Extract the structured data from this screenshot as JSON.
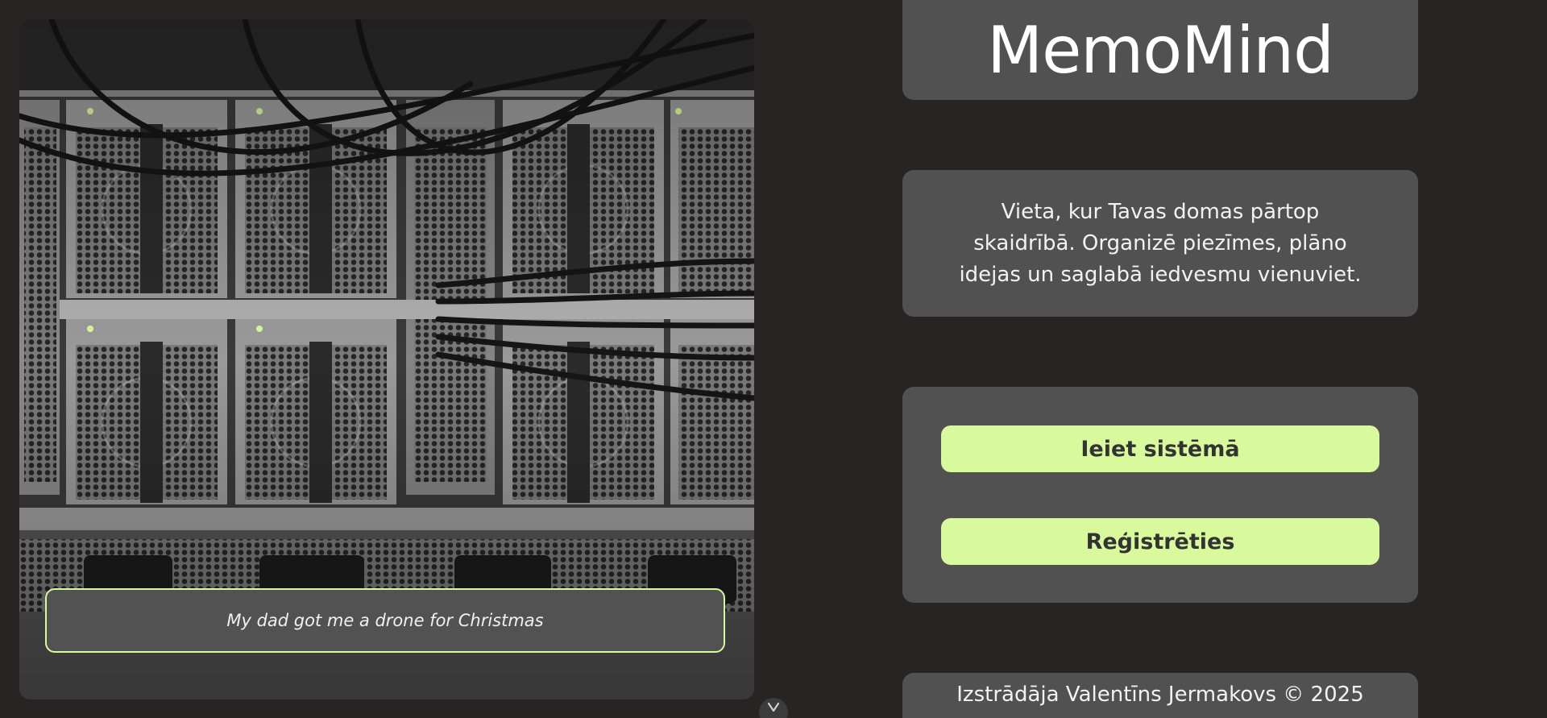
{
  "hero": {
    "quote": "My dad got me a drone for Christmas"
  },
  "brand": {
    "title": "MemoMind"
  },
  "tagline": {
    "line1": "Vieta, kur Tavas domas pārtop",
    "line2": "skaidrībā. Organizē piezīmes, plāno",
    "line3": "idejas un saglabā iedvesmu vienuviet."
  },
  "auth": {
    "login_label": "Ieiet sistēmā",
    "register_label": "Reģistrēties"
  },
  "footer": {
    "credit": "Izstrādāja Valentīns Jermakovs © 2025"
  },
  "icons": {
    "scroll": "chevron-down-icon"
  },
  "colors": {
    "background": "#282423",
    "panel": "#515151",
    "accent": "#d9f99d",
    "button_text": "#333333"
  }
}
